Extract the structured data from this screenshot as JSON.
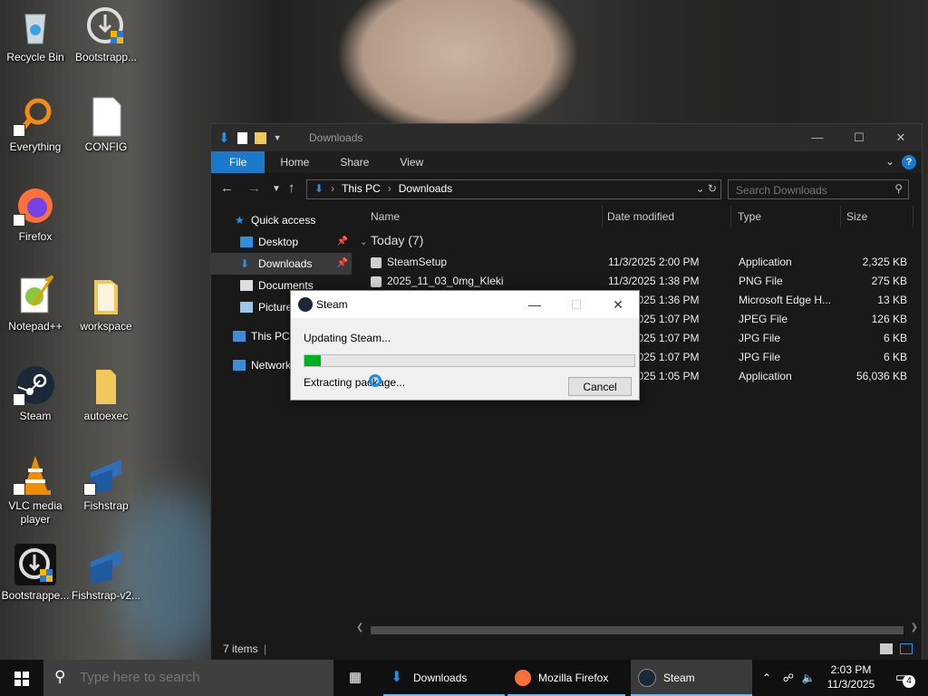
{
  "desktop": {
    "icons": [
      {
        "label": "Recycle Bin"
      },
      {
        "label": "Bootstrapp..."
      },
      {
        "label": "Everything"
      },
      {
        "label": "CONFIG"
      },
      {
        "label": "Firefox"
      },
      {
        "label": "Notepad++"
      },
      {
        "label": "workspace"
      },
      {
        "label": "Steam"
      },
      {
        "label": "autoexec"
      },
      {
        "label": "VLC media player"
      },
      {
        "label": "Fishstrap"
      },
      {
        "label": "Bootstrappe..."
      },
      {
        "label": "Fishstrap-v2..."
      }
    ]
  },
  "explorer": {
    "title": "Downloads",
    "ribbon_tabs": [
      "File",
      "Home",
      "Share",
      "View"
    ],
    "help_label": "?",
    "address": {
      "crumbs": [
        "This PC",
        "Downloads"
      ]
    },
    "search_placeholder": "Search Downloads",
    "nav": [
      {
        "label": "Quick access"
      },
      {
        "label": "Desktop"
      },
      {
        "label": "Downloads"
      },
      {
        "label": "Documents"
      },
      {
        "label": "Pictures"
      },
      {
        "label": "This PC"
      },
      {
        "label": "Network"
      }
    ],
    "columns": [
      "Name",
      "Date modified",
      "Type",
      "Size"
    ],
    "group_label": "Today (7)",
    "files": [
      {
        "name": "SteamSetup",
        "date": "11/3/2025 2:00 PM",
        "type": "Application",
        "size": "2,325 KB"
      },
      {
        "name": "2025_11_03_0mg_Kleki",
        "date": "11/3/2025 1:38 PM",
        "type": "PNG File",
        "size": "275 KB"
      },
      {
        "name": "",
        "date": "11/3/2025 1:36 PM",
        "type": "Microsoft Edge H...",
        "size": "13 KB"
      },
      {
        "name": "",
        "date": "11/3/2025 1:07 PM",
        "type": "JPEG File",
        "size": "126 KB"
      },
      {
        "name": "",
        "date": "11/3/2025 1:07 PM",
        "type": "JPG File",
        "size": "6 KB"
      },
      {
        "name": "",
        "date": "11/3/2025 1:07 PM",
        "type": "JPG File",
        "size": "6 KB"
      },
      {
        "name": "",
        "date": "11/3/2025 1:05 PM",
        "type": "Application",
        "size": "56,036 KB"
      }
    ],
    "status": "7 items"
  },
  "dialog": {
    "title": "Steam",
    "message": "Updating Steam...",
    "progress_fraction": 0.05,
    "substatus": "Extracting package...",
    "cancel_label": "Cancel"
  },
  "taskbar": {
    "search_placeholder": "Type here to search",
    "items": [
      {
        "label": "Downloads"
      },
      {
        "label": "Mozilla Firefox"
      },
      {
        "label": "Steam"
      }
    ],
    "time": "2:03 PM",
    "date": "11/3/2025",
    "notification_count": "4"
  },
  "colors": {
    "accent": "#1979ca",
    "progress": "#06b025",
    "taskbar": "#101010"
  }
}
